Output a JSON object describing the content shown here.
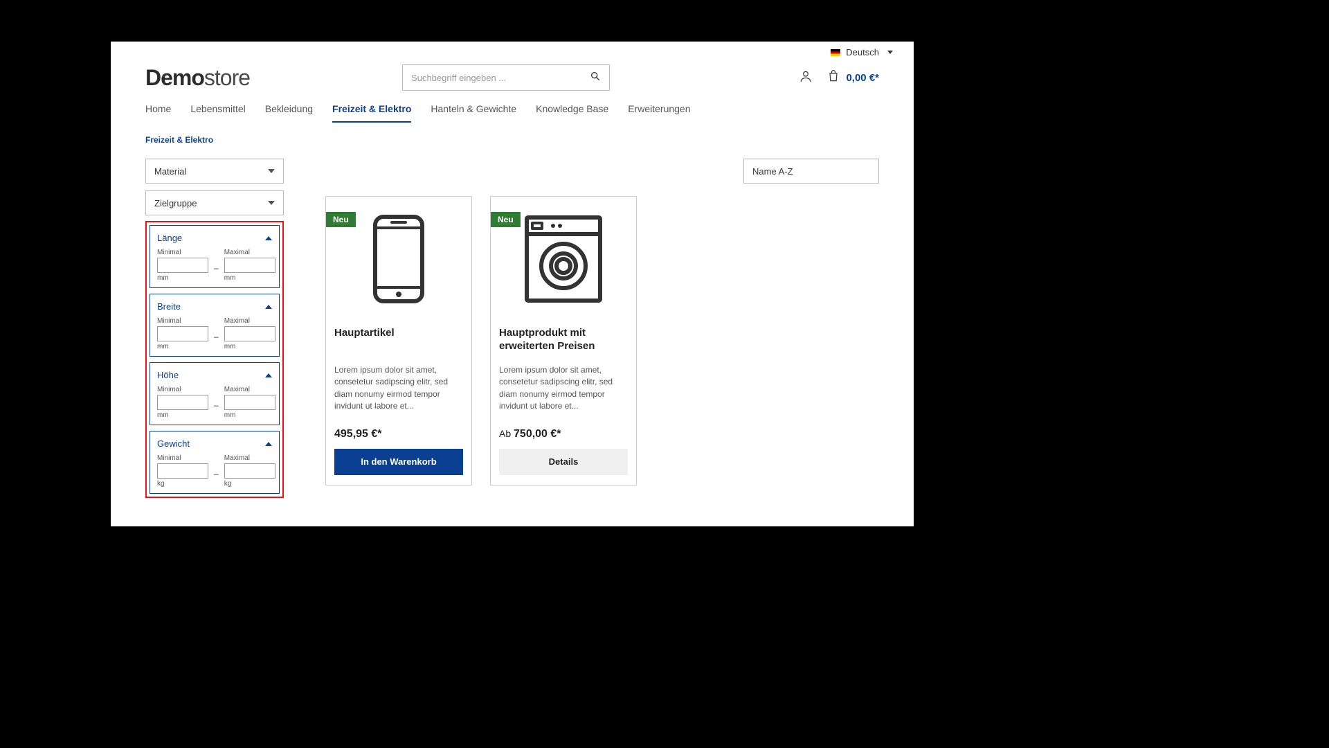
{
  "topbar": {
    "language": "Deutsch"
  },
  "logo": {
    "bold": "Demo",
    "light": "store"
  },
  "search": {
    "placeholder": "Suchbegriff eingeben ..."
  },
  "cart": {
    "total": "0,00 €*"
  },
  "nav": {
    "items": [
      {
        "label": "Home"
      },
      {
        "label": "Lebensmittel"
      },
      {
        "label": "Bekleidung"
      },
      {
        "label": "Freizeit & Elektro"
      },
      {
        "label": "Hanteln & Gewichte"
      },
      {
        "label": "Knowledge Base"
      },
      {
        "label": "Erweiterungen"
      }
    ],
    "active_index": 3
  },
  "breadcrumb": "Freizeit & Elektro",
  "sidebar": {
    "material_label": "Material",
    "zielgruppe_label": "Zielgruppe",
    "filters": [
      {
        "title": "Länge",
        "min_label": "Minimal",
        "max_label": "Maximal",
        "unit": "mm"
      },
      {
        "title": "Breite",
        "min_label": "Minimal",
        "max_label": "Maximal",
        "unit": "mm"
      },
      {
        "title": "Höhe",
        "min_label": "Minimal",
        "max_label": "Maximal",
        "unit": "mm"
      },
      {
        "title": "Gewicht",
        "min_label": "Minimal",
        "max_label": "Maximal",
        "unit": "kg"
      }
    ]
  },
  "sort": {
    "selected": "Name A-Z"
  },
  "products": [
    {
      "badge": "Neu",
      "title": "Hauptartikel",
      "desc": "Lorem ipsum dolor sit amet, consetetur sadipscing elitr, sed diam nonumy eirmod tempor invidunt ut labore et...",
      "price_prefix": "",
      "price": "495,95 €*",
      "cta": "In den Warenkorb",
      "cta_style": "primary",
      "icon": "phone"
    },
    {
      "badge": "Neu",
      "title": "Hauptprodukt mit erweiterten Preisen",
      "desc": "Lorem ipsum dolor sit amet, consetetur sadipscing elitr, sed diam nonumy eirmod tempor invidunt ut labore et...",
      "price_prefix": "Ab ",
      "price": "750,00 €*",
      "cta": "Details",
      "cta_style": "secondary",
      "icon": "washer"
    }
  ]
}
